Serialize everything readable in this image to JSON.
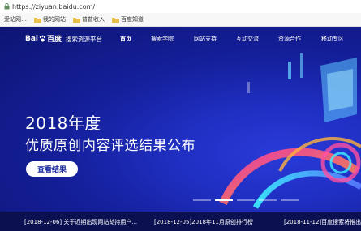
{
  "browser": {
    "url": "https://ziyuan.baidu.com/",
    "bookmarks": [
      "爱站网…",
      "我的网站",
      "普普收入",
      "百度知道"
    ]
  },
  "nav": {
    "logo_text": "Bai",
    "logo_text2": "百度",
    "platform": "搜索资源平台",
    "items": [
      "首页",
      "搜索学院",
      "网站支持",
      "互动交流",
      "资源合作",
      "移动专区"
    ]
  },
  "hero": {
    "title_line1": "2018年度",
    "title_line2": "优质原创内容评选结果公布",
    "cta": "查看结果"
  },
  "news": [
    "[2018-12-06] 关于近期出现网站劫持用户...",
    "[2018-12-05]2018年11月原创排行榜",
    "[2018-11-12]百度搜索将推出小"
  ],
  "colors": {
    "hero_bg": "#141f9a",
    "news_bg": "#0b1150",
    "cta_text": "#1b2a9e"
  }
}
